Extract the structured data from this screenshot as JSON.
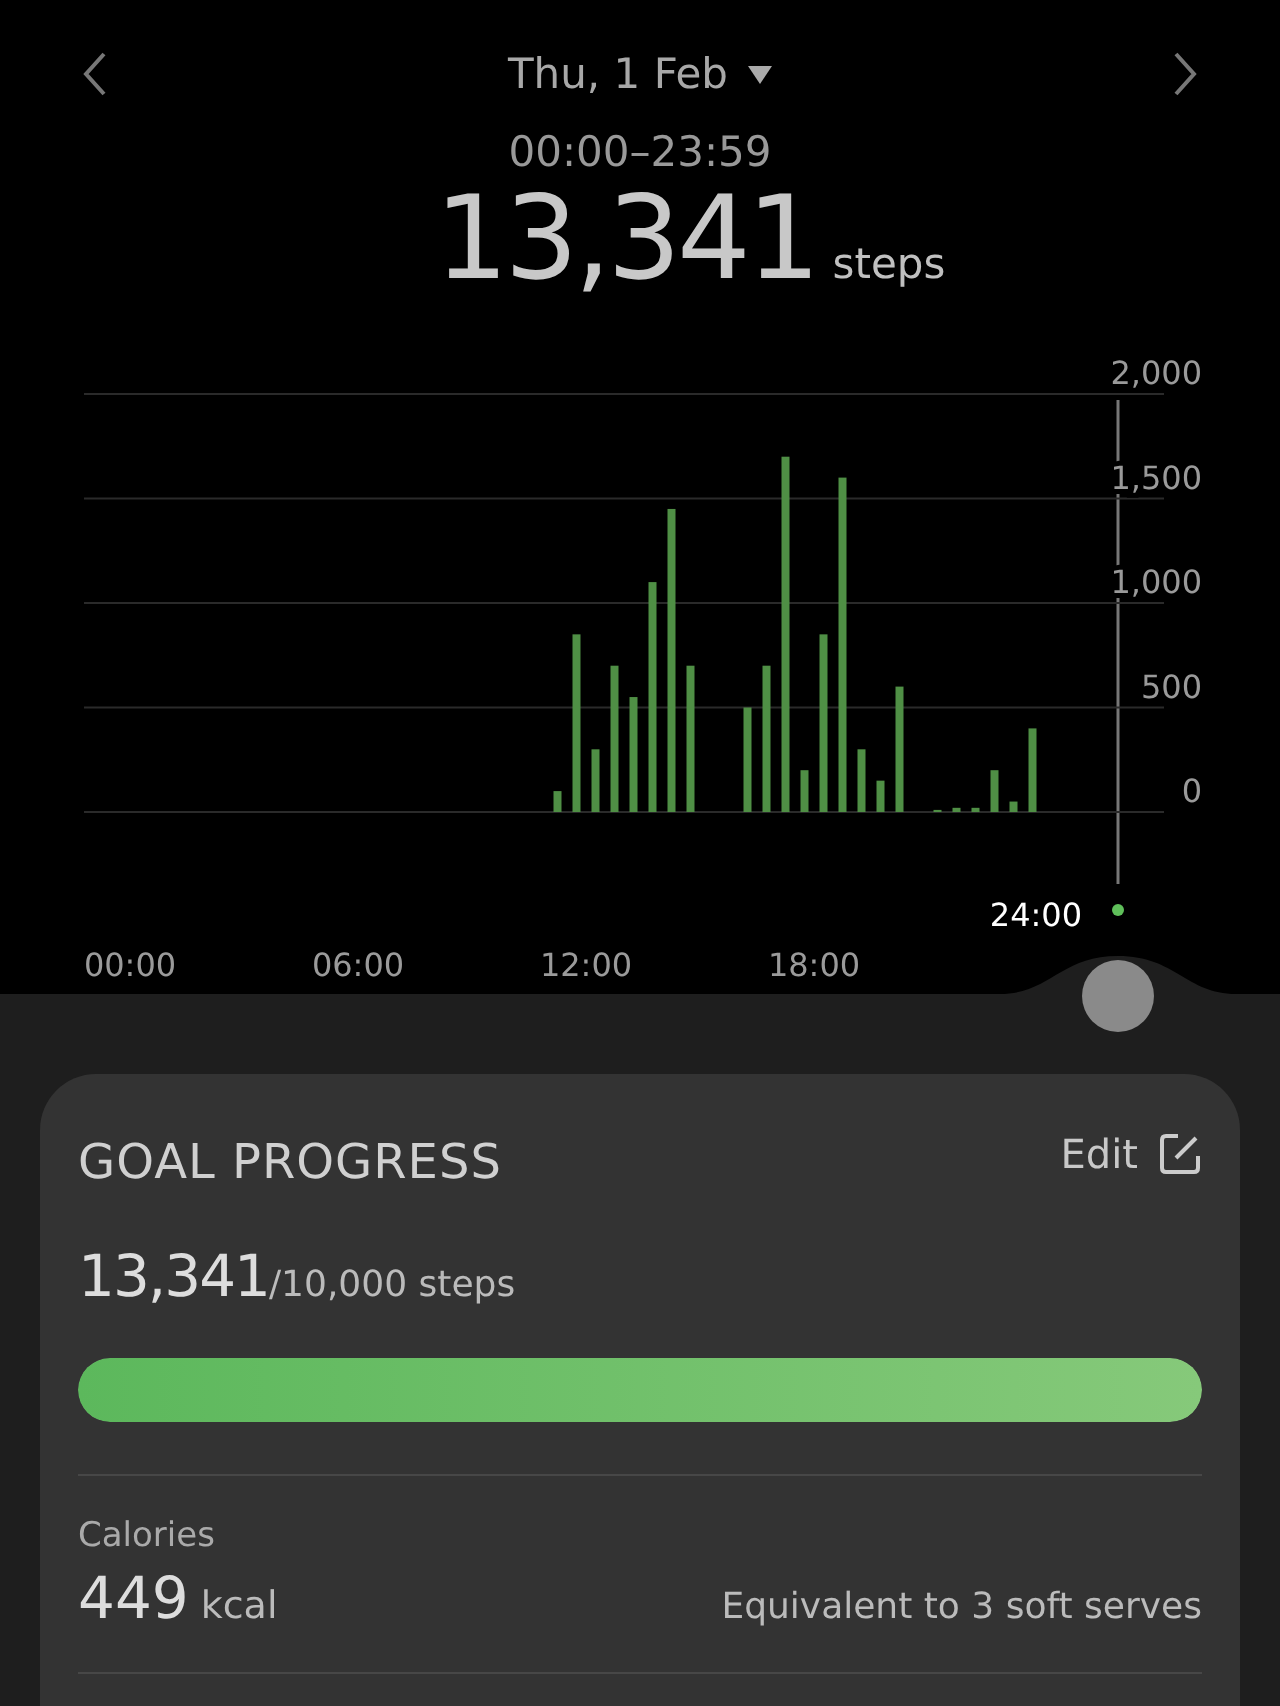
{
  "header": {
    "date": "Thu, 1 Feb",
    "time_range": "00:00–23:59",
    "total": "13,341",
    "unit": "steps"
  },
  "chart": {
    "cursor_label": "24:00",
    "chart_data": {
      "type": "bar",
      "x": [
        11.25,
        11.75,
        12.25,
        12.75,
        13.25,
        13.75,
        14.25,
        14.75,
        16.25,
        16.75,
        17.25,
        17.75,
        18.25,
        18.75,
        19.25,
        19.75,
        20.25,
        21.25,
        21.75,
        22.25,
        22.75,
        23.25,
        23.75
      ],
      "series": [
        {
          "color": "#4f8f45",
          "values": [
            100,
            850,
            300,
            700,
            550,
            1100,
            1450,
            700,
            500,
            700,
            1700,
            200,
            850,
            1600,
            300,
            150,
            600,
            10,
            20,
            20,
            200,
            50,
            400
          ]
        }
      ],
      "xlim": [
        0,
        24
      ],
      "ylim": [
        0,
        2000
      ],
      "grid": true,
      "xticks": [
        {
          "value": 0,
          "label": "00:00"
        },
        {
          "value": 6,
          "label": "06:00"
        },
        {
          "value": 12,
          "label": "12:00"
        },
        {
          "value": 18,
          "label": "18:00"
        }
      ],
      "yticks": [
        {
          "value": 0,
          "label": "0"
        },
        {
          "value": 500,
          "label": "500"
        },
        {
          "value": 1000,
          "label": "1,000"
        },
        {
          "value": 1500,
          "label": "1,500"
        },
        {
          "value": 2000,
          "label": "2,000"
        }
      ]
    }
  },
  "goal": {
    "title": "GOAL PROGRESS",
    "edit": "Edit",
    "current": "13,341",
    "target": "/10,000 steps",
    "level": 1,
    "calories_label": "Calories",
    "calories_value": "449",
    "calories_unit": "kcal",
    "equivalent": "Equivalent to 3 soft serves"
  }
}
